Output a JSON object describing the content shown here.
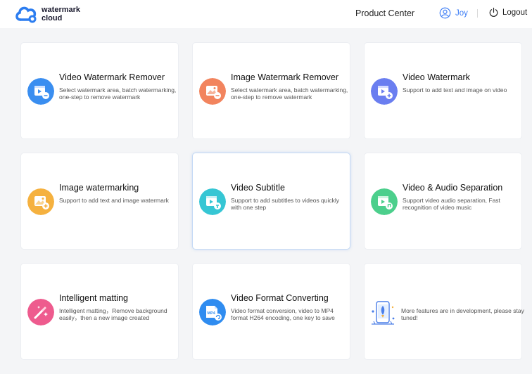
{
  "header": {
    "logo_line1": "watermark",
    "logo_line2": "cloud",
    "product_center": "Product Center",
    "user_name": "Joy",
    "logout": "Logout"
  },
  "colors": {
    "accent": "#3b7cf5",
    "video_watermark_remover": "#3a8ef0",
    "image_watermark_remover": "#f2845e",
    "video_watermark": "#6a7ef0",
    "image_watermarking": "#f5b13f",
    "video_subtitle": "#36c6d4",
    "video_audio_separation": "#4ccf8c",
    "intelligent_matting": "#ee5b8e",
    "video_format_converting": "#2f8cf0"
  },
  "tools": [
    {
      "title": "Video Watermark Remover",
      "desc": "Select watermark area, batch watermarking, one-step to remove watermark",
      "icon": "video-watermark-remover-icon"
    },
    {
      "title": "Image Watermark Remover",
      "desc": "Select watermark area, batch watermarking, one-step to remove watermark",
      "icon": "image-watermark-remover-icon"
    },
    {
      "title": "Video Watermark",
      "desc": "Support to add text and image on video",
      "icon": "video-watermark-icon"
    },
    {
      "title": "Image watermarking",
      "desc": "Support to add text and image watermark",
      "icon": "image-watermarking-icon"
    },
    {
      "title": "Video Subtitle",
      "desc": "Support to add subtitles to videos quickly with one step",
      "icon": "video-subtitle-icon"
    },
    {
      "title": "Video & Audio Separation",
      "desc": "Support video audio separation, Fast recognition of video music",
      "icon": "video-audio-separation-icon"
    },
    {
      "title": "Intelligent matting",
      "desc": "Intelligent matting，Remove background easily，then a new image created",
      "icon": "intelligent-matting-icon"
    },
    {
      "title": "Video Format Converting",
      "desc": "Video format conversion, video to MP4 format H264 encoding, one key to save",
      "icon": "video-format-converting-icon"
    },
    {
      "title": "",
      "desc": "More features are in development, please stay tuned!",
      "icon": "more-features-illustration"
    }
  ],
  "mp4_badge": "MP4"
}
